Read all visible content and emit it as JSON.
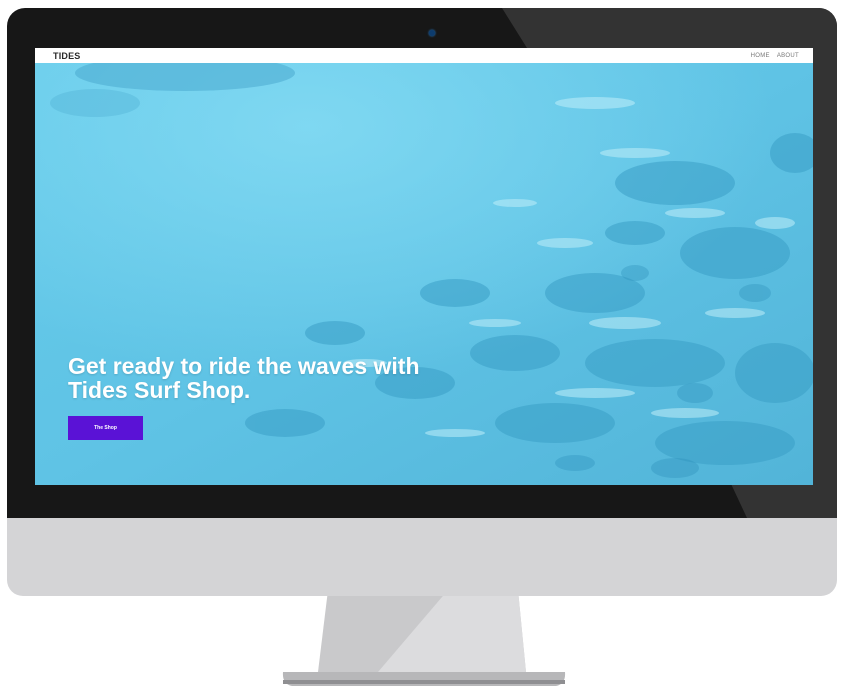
{
  "site": {
    "brand": "TIDES",
    "nav": {
      "home_label": "HOME",
      "about_label": "ABOUT"
    },
    "hero": {
      "headline_line1": "Get ready to ride the waves with",
      "headline_line2": "Tides Surf Shop.",
      "cta_label": "The Shop"
    }
  },
  "colors": {
    "accent": "#5a12d6",
    "water": "#63c7e8",
    "bezel": "#171717",
    "chin": "#d4d4d6"
  }
}
